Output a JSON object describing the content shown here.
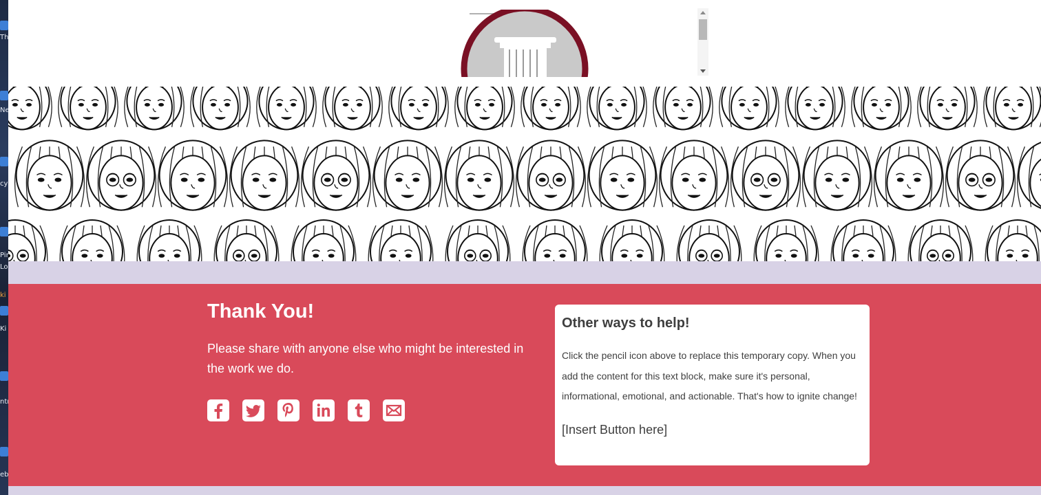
{
  "desktop_strip": {
    "labels": [
      "Th",
      "Ne",
      "cy",
      "Pin",
      "Lo",
      "ki",
      "Ki",
      "ntr",
      "eb"
    ]
  },
  "header": {
    "logo": {
      "name": "column-seal-logo",
      "ring_color": "#7a1024"
    }
  },
  "banner": {
    "image_name": "diverse-women-faces-illustration"
  },
  "thank_you": {
    "title": "Thank You!",
    "text": "Please share with anyone else who might be interested in the work we do.",
    "social": [
      {
        "name": "facebook-icon",
        "label": "f"
      },
      {
        "name": "twitter-icon",
        "label": "t"
      },
      {
        "name": "pinterest-icon",
        "label": "p"
      },
      {
        "name": "linkedin-icon",
        "label": "in"
      },
      {
        "name": "tumblr-icon",
        "label": "t"
      },
      {
        "name": "email-icon",
        "label": "mail"
      }
    ]
  },
  "help_card": {
    "title": "Other ways to help!",
    "body": "Click the pencil icon above to replace this temporary copy. When you add the content for this text block, make sure it's personal, informational, emotional, and actionable. That's how to ignite change!",
    "button": "[Insert Button here]"
  },
  "colors": {
    "red_section": "#d94a5a",
    "lavender": "#d8d2e6",
    "card_text": "#3e3e3e"
  }
}
